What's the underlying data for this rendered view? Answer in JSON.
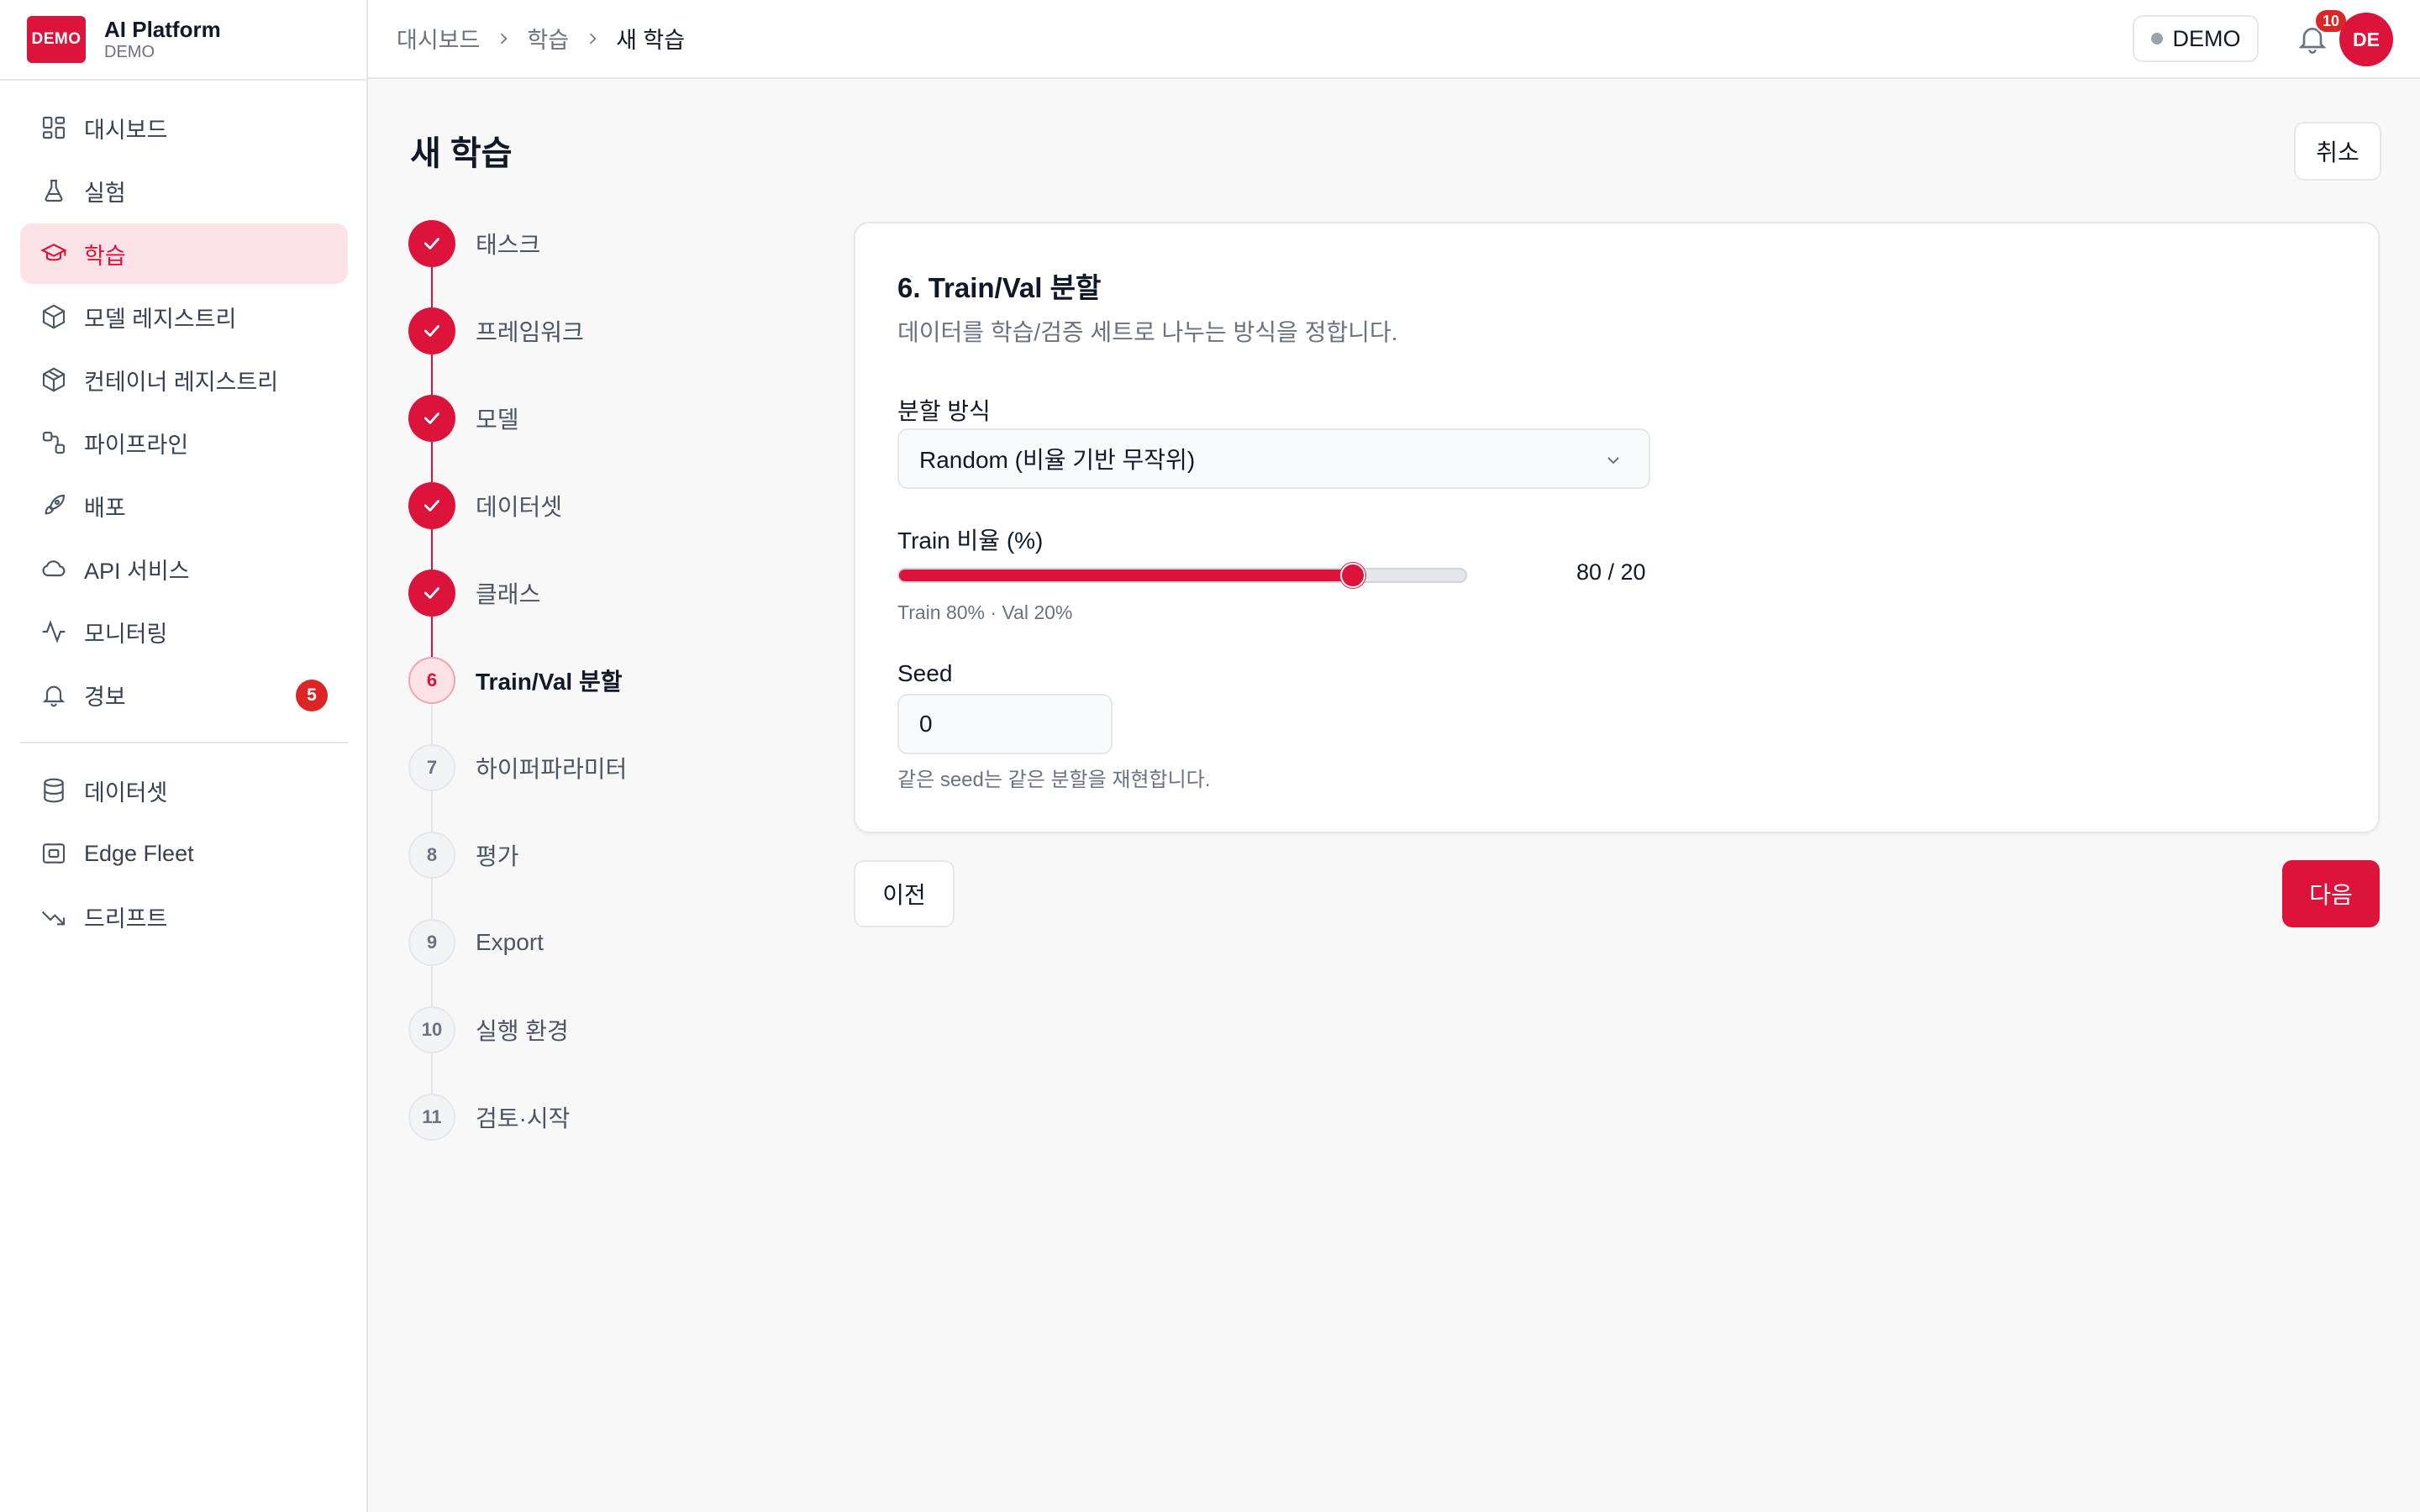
{
  "brand": {
    "logo_text": "DEMO",
    "name": "AI Platform",
    "sub": "DEMO"
  },
  "sidebar": {
    "items": [
      {
        "label": "대시보드",
        "icon": "dashboard-icon"
      },
      {
        "label": "실험",
        "icon": "flask-icon"
      },
      {
        "label": "학습",
        "icon": "graduation-cap-icon",
        "active": true
      },
      {
        "label": "모델 레지스트리",
        "icon": "cube-icon"
      },
      {
        "label": "컨테이너 레지스트리",
        "icon": "container-icon"
      },
      {
        "label": "파이프라인",
        "icon": "pipeline-icon"
      },
      {
        "label": "배포",
        "icon": "rocket-icon"
      },
      {
        "label": "API 서비스",
        "icon": "cloud-icon"
      },
      {
        "label": "모니터링",
        "icon": "activity-icon"
      },
      {
        "label": "경보",
        "icon": "bell-icon",
        "badge": "5"
      }
    ],
    "items2": [
      {
        "label": "데이터셋",
        "icon": "database-icon"
      },
      {
        "label": "Edge Fleet",
        "icon": "chip-icon"
      },
      {
        "label": "드리프트",
        "icon": "trend-down-icon"
      }
    ]
  },
  "header": {
    "breadcrumb": [
      "대시보드",
      "학습",
      "새 학습"
    ],
    "env": "DEMO",
    "notifications": "10",
    "avatar": "DE"
  },
  "page": {
    "title": "새 학습",
    "cancel": "취소"
  },
  "steps": [
    {
      "num": "1",
      "label": "태스크",
      "state": "done"
    },
    {
      "num": "2",
      "label": "프레임워크",
      "state": "done"
    },
    {
      "num": "3",
      "label": "모델",
      "state": "done"
    },
    {
      "num": "4",
      "label": "데이터셋",
      "state": "done"
    },
    {
      "num": "5",
      "label": "클래스",
      "state": "done"
    },
    {
      "num": "6",
      "label": "Train/Val 분할",
      "state": "current"
    },
    {
      "num": "7",
      "label": "하이퍼파라미터",
      "state": "todo"
    },
    {
      "num": "8",
      "label": "평가",
      "state": "todo"
    },
    {
      "num": "9",
      "label": "Export",
      "state": "todo"
    },
    {
      "num": "10",
      "label": "실행 환경",
      "state": "todo"
    },
    {
      "num": "11",
      "label": "검토·시작",
      "state": "todo"
    }
  ],
  "card": {
    "title": "6. Train/Val 분할",
    "desc": "데이터를 학습/검증 세트로 나누는 방식을 정합니다.",
    "split_label": "분할 방식",
    "split_value": "Random (비율 기반 무작위)",
    "ratio_label": "Train 비율 (%)",
    "ratio_percent": 80,
    "ratio_value": "80 / 20",
    "ratio_hint": "Train 80% · Val 20%",
    "seed_label": "Seed",
    "seed_value": "0",
    "seed_hint": "같은 seed는 같은 분할을 재현합니다."
  },
  "buttons": {
    "prev": "이전",
    "next": "다음"
  },
  "colors": {
    "accent": "#dc143c",
    "accent_light": "#fde2e7",
    "badge": "#dc2626"
  }
}
